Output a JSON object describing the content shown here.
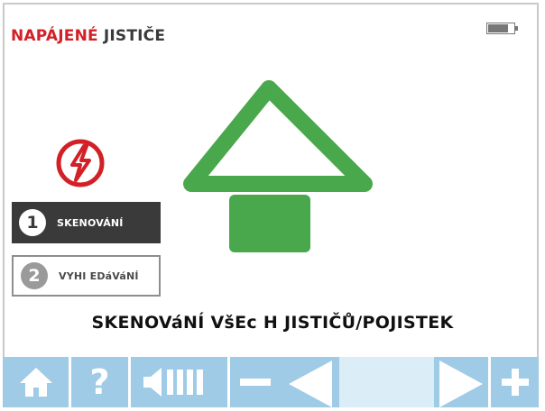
{
  "header": {
    "title_part1": "NAPÁJENÉ",
    "title_part2": "JISTIČE"
  },
  "status": {
    "battery_icon": "battery-icon"
  },
  "main": {
    "hazard_icon": "electric-hazard-icon",
    "arrow_icon": "up-arrow-icon",
    "steps": [
      {
        "number": "1",
        "label": "SKENOVÁNÍ",
        "active": true
      },
      {
        "number": "2",
        "label": "VYHI EDáVáNÍ",
        "active": false
      }
    ],
    "instruction": "SKENOVáNÍ VšEc H JISTIČŮ/POJISTEK"
  },
  "toolbar": {
    "home_icon": "home-icon",
    "help_label": "?",
    "volume_icon": "volume-icon",
    "minus_icon": "minus-icon",
    "prev_icon": "left-triangle-icon",
    "next_icon": "right-triangle-icon",
    "plus_icon": "plus-icon"
  },
  "colors": {
    "accent_red": "#d32027",
    "arrow_green": "#4aa84c",
    "toolbar_blue": "#9fcbe6",
    "dark": "#3a3a3a"
  }
}
